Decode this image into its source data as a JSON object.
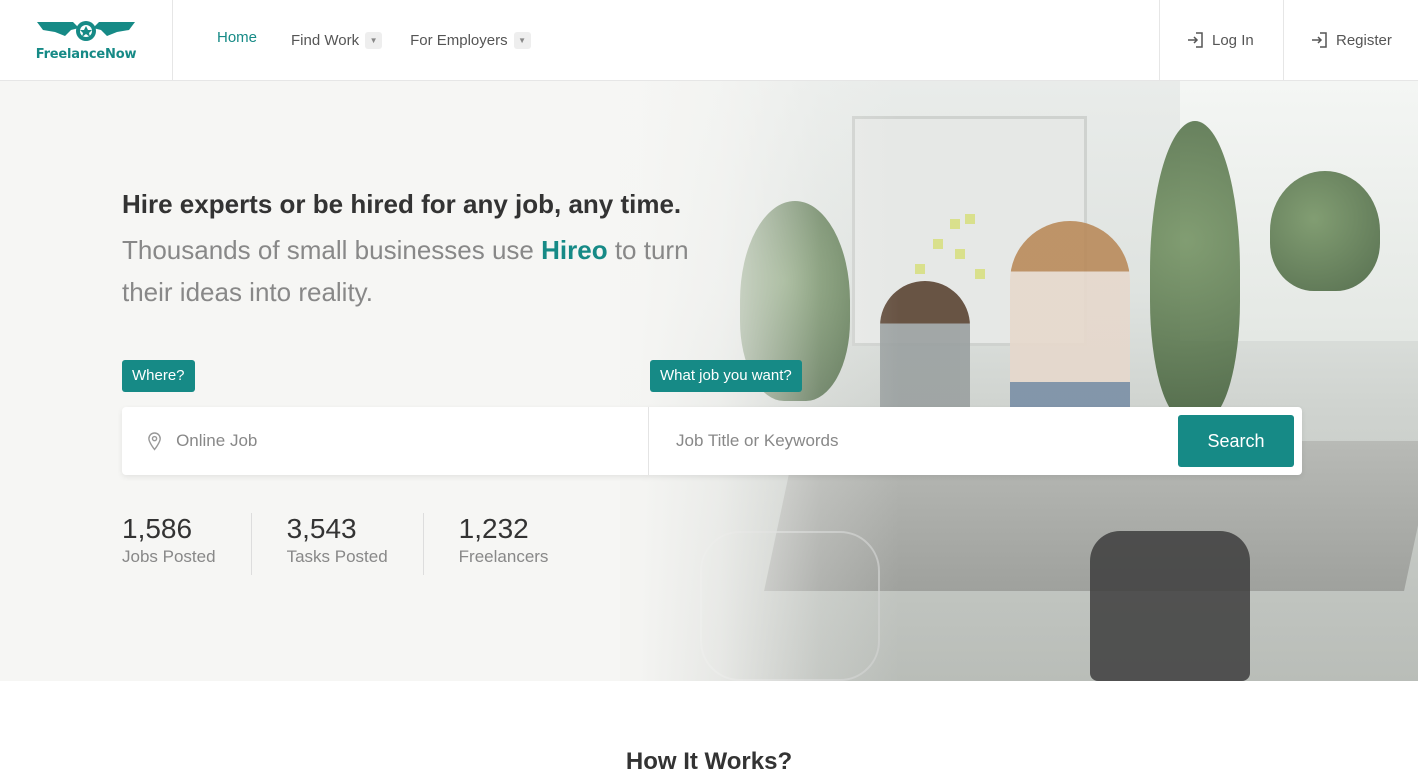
{
  "brand": {
    "logo_text": "FreelanceNow",
    "color": "#168a86"
  },
  "nav": {
    "items": [
      {
        "label": "Home",
        "active": true
      },
      {
        "label": "Find Work",
        "has_dropdown": true
      },
      {
        "label": "For Employers",
        "has_dropdown": true
      }
    ]
  },
  "auth": {
    "login_label": "Log In",
    "register_label": "Register"
  },
  "hero": {
    "headline": "Hire experts or be hired for any job, any time.",
    "sub_before": "Thousands of small businesses use ",
    "sub_brand": "Hireo",
    "sub_after": " to turn their ideas into reality."
  },
  "search": {
    "where_label": "Where?",
    "what_label": "What job you want?",
    "location_placeholder": "Online Job",
    "keywords_placeholder": "Job Title or Keywords",
    "button_label": "Search"
  },
  "stats": [
    {
      "value": "1,586",
      "label": "Jobs Posted"
    },
    {
      "value": "3,543",
      "label": "Tasks Posted"
    },
    {
      "value": "1,232",
      "label": "Freelancers"
    }
  ],
  "sections": {
    "how_it_works_title": "How It Works?"
  },
  "icons": [
    "logo-icon",
    "chevron-down-icon",
    "login-icon",
    "register-icon",
    "location-pin-icon"
  ]
}
